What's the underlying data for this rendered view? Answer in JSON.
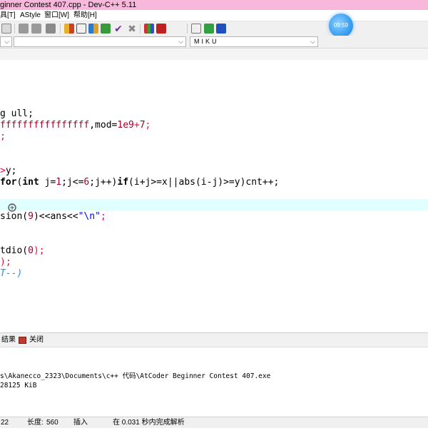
{
  "window": {
    "title": "ginner Contest 407.cpp - Dev-C++ 5.11"
  },
  "menu": [
    "具[T]",
    "AStyle",
    "窗口[W]",
    "帮助[H]"
  ],
  "clock": "09:59",
  "combos": {
    "left": "",
    "middle": "",
    "right": "MIKU"
  },
  "code_lines": [
    [
      {
        "t": "g ull;",
        "c": "pl"
      }
    ],
    [
      {
        "t": "ffffffffffffffff",
        "c": "num"
      },
      {
        "t": ",mod=",
        "c": "pl"
      },
      {
        "t": "1e9",
        "c": "num"
      },
      {
        "t": "+",
        "c": "op"
      },
      {
        "t": "7",
        "c": "num"
      },
      {
        "t": ";",
        "c": "op"
      }
    ],
    [
      {
        "t": ";",
        "c": "op"
      }
    ],
    [],
    [],
    [
      {
        "t": ">",
        "c": "op"
      },
      {
        "t": "y;",
        "c": "pl"
      }
    ],
    [
      {
        "t": "for",
        "c": "kw"
      },
      {
        "t": "(",
        "c": "pl"
      },
      {
        "t": "int",
        "c": "kw"
      },
      {
        "t": " j=",
        "c": "pl"
      },
      {
        "t": "1",
        "c": "num"
      },
      {
        "t": ";j<=",
        "c": "pl"
      },
      {
        "t": "6",
        "c": "num"
      },
      {
        "t": ";j++)",
        "c": "pl"
      },
      {
        "t": "if",
        "c": "kw"
      },
      {
        "t": "(i+j>=x||abs(i-j)>=y)cnt++;",
        "c": "pl"
      }
    ],
    [],
    [],
    [
      {
        "t": "sion(",
        "c": "pl"
      },
      {
        "t": "9",
        "c": "num"
      },
      {
        "t": ")<<ans<<",
        "c": "pl"
      },
      {
        "t": "\"\\n\"",
        "c": "str"
      },
      {
        "t": ";",
        "c": "op"
      }
    ],
    [],
    [],
    [
      {
        "t": "tdio(",
        "c": "pl"
      },
      {
        "t": "0",
        "c": "num"
      },
      {
        "t": ");",
        "c": "op"
      }
    ],
    [
      {
        "t": ");",
        "c": "op"
      }
    ],
    [
      {
        "t": "T--)",
        "c": "cm"
      }
    ]
  ],
  "tabs": {
    "results": "结果",
    "close": "关闭"
  },
  "output_lines": [
    "s\\Akanecco_2323\\Documents\\c++ 代码\\AtCoder Beginner Contest 407.exe",
    "28125 KiB"
  ],
  "status": {
    "line": "22",
    "length_label": "长度:",
    "length_value": "560",
    "mode": "插入",
    "parse": "在 0.031 秒内完成解析"
  },
  "colors": {
    "titlebar": "#f7b8dc",
    "highlight_line": "#e0ffff",
    "keyword": "#000000",
    "number": "#a0002a",
    "operator": "#ff0040",
    "string": "#0000ff",
    "comment": "#1e90ff"
  }
}
